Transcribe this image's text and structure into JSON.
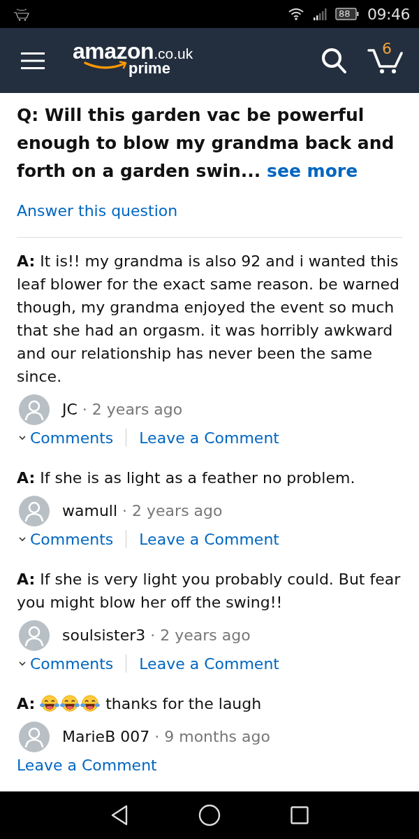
{
  "status_bar": {
    "battery": "88",
    "time": "09:46"
  },
  "header": {
    "logo": {
      "name": "amazon",
      "domain": ".co.uk",
      "tier": "prime"
    },
    "cart_count": "6"
  },
  "question": {
    "prefix": "Q:",
    "text": "Will this garden vac be powerful enough to blow my grandma back and forth on a garden swin...",
    "link": "see more"
  },
  "answer_link": "Answer this question",
  "answers": [
    {
      "prefix": "A:",
      "text": "It is!! my grandma is also 92 and i wanted this leaf blower for the exact same reason. be warned though, my grandma enjoyed the event so much that she had an orgasm. it was horribly awkward and our relationship has never been the same since.",
      "author": "JC",
      "meta": "· 2 years ago",
      "comments_link": "Comments",
      "leave_comment_link": "Leave a Comment"
    },
    {
      "prefix": "A:",
      "text": "If she is as light as a feather no problem.",
      "author": "wamull",
      "meta": "· 2 years ago",
      "comments_link": "Comments",
      "leave_comment_link": "Leave a Comment"
    },
    {
      "prefix": "A:",
      "text": "If she is very light you probably could. But fear you might blow her off the swing!!",
      "author": "soulsister3",
      "meta": "· 2 years ago",
      "comments_link": "Comments",
      "leave_comment_link": "Leave a Comment"
    },
    {
      "prefix": "A:",
      "emojis": [
        {
          "kind": "tears-of-joy"
        },
        {
          "kind": "tears-of-joy"
        },
        {
          "kind": "tears-of-joy"
        }
      ],
      "text": "thanks for the laugh",
      "author": "MarieB 007",
      "meta": "· 9 months ago",
      "leave_comment_link": "Leave a Comment"
    }
  ]
}
